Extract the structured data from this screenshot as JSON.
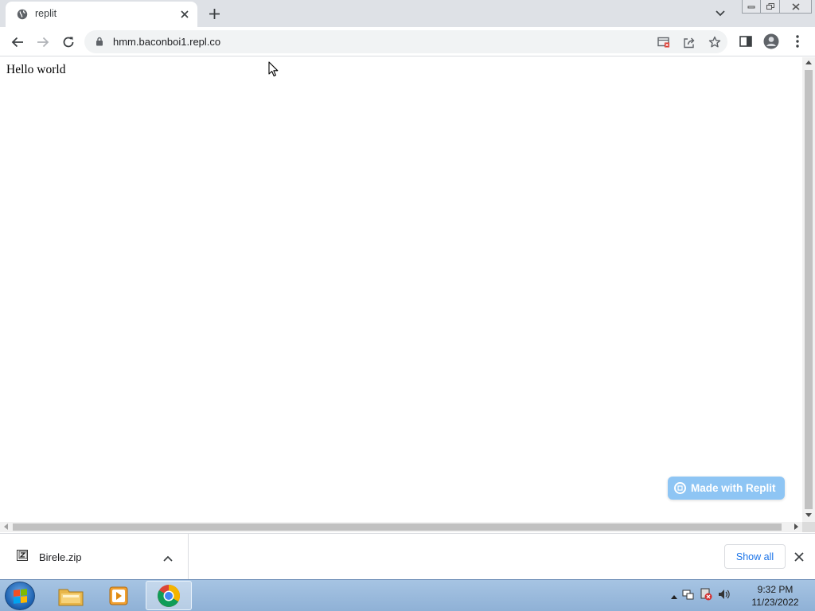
{
  "browser": {
    "tab": {
      "title": "replit",
      "favicon": "globe-icon"
    },
    "address_bar": {
      "url": "hmm.baconboi1.repl.co"
    }
  },
  "page": {
    "text": "Hello world",
    "badge_label": "Made with Replit"
  },
  "download_bar": {
    "file_name": "Birele.zip",
    "show_all_label": "Show all"
  },
  "taskbar": {
    "time": "9:32 PM",
    "date": "11/23/2022",
    "apps": [
      "file-explorer-icon",
      "media-player-icon",
      "chrome-icon"
    ]
  },
  "colors": {
    "tabstrip": "#dee1e6",
    "accent_link": "#1a73e8",
    "replit_badge": "#8ec5f4"
  }
}
